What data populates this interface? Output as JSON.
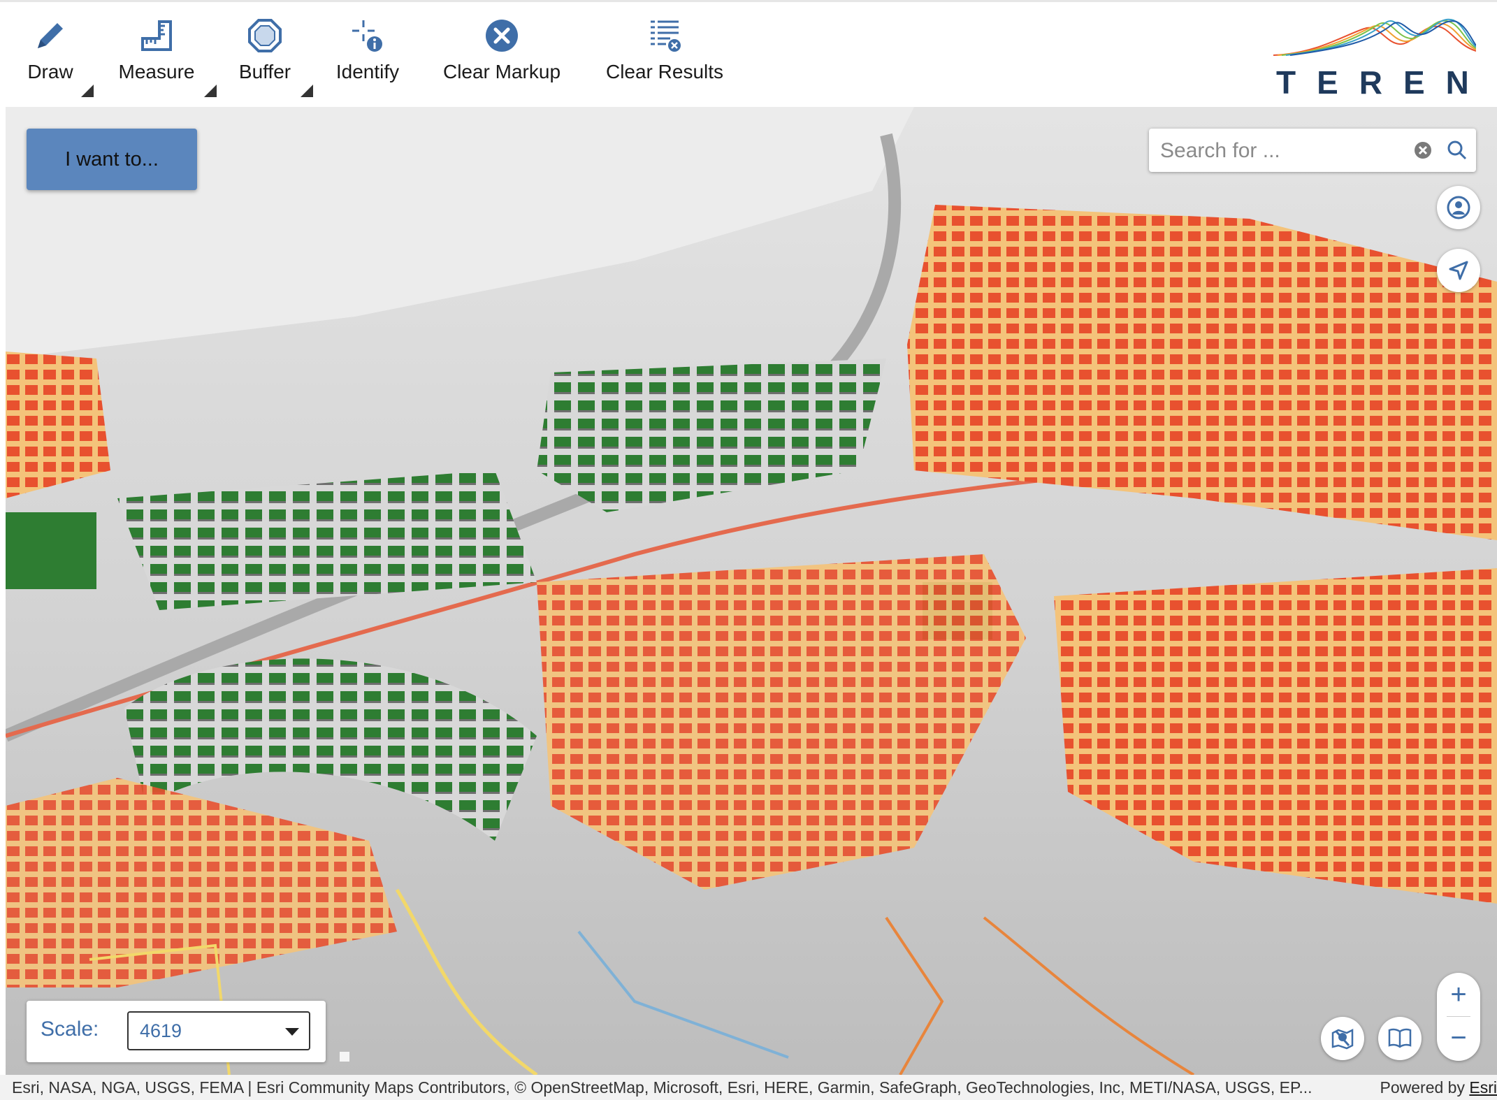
{
  "toolbar": {
    "draw": "Draw",
    "measure": "Measure",
    "buffer": "Buffer",
    "identify": "Identify",
    "clear_markup": "Clear Markup",
    "clear_results": "Clear Results"
  },
  "logo": {
    "word": "TEREN"
  },
  "map": {
    "i_want_to": "I want to...",
    "search_placeholder": "Search for ...",
    "zoom_in": "+",
    "zoom_out": "−",
    "scale_label": "Scale:",
    "scale_value": "4619"
  },
  "attribution": {
    "text": "Esri, NASA, NGA, USGS, FEMA | Esri Community Maps Contributors, © OpenStreetMap, Microsoft, Esri, HERE, Garmin, SafeGraph, GeoTechnologies, Inc, METI/NASA, USGS, EP...",
    "powered_by": "Powered by",
    "esri": "Esri"
  },
  "colors": {
    "accent": "#3f6ea8",
    "button": "#5b86bd",
    "high_risk": "#e8512f",
    "low_risk": "#2e7d32",
    "flow_yellow": "#f2d86a",
    "flow_blue": "#7fb1d6"
  },
  "icons": [
    "pencil-icon",
    "ruler-icon",
    "buffer-icon",
    "identify-icon",
    "clear-circle-icon",
    "clear-list-icon",
    "clear-search-icon",
    "search-icon",
    "person-icon",
    "locate-arrow-icon",
    "map-marker-icon",
    "book-icon"
  ]
}
